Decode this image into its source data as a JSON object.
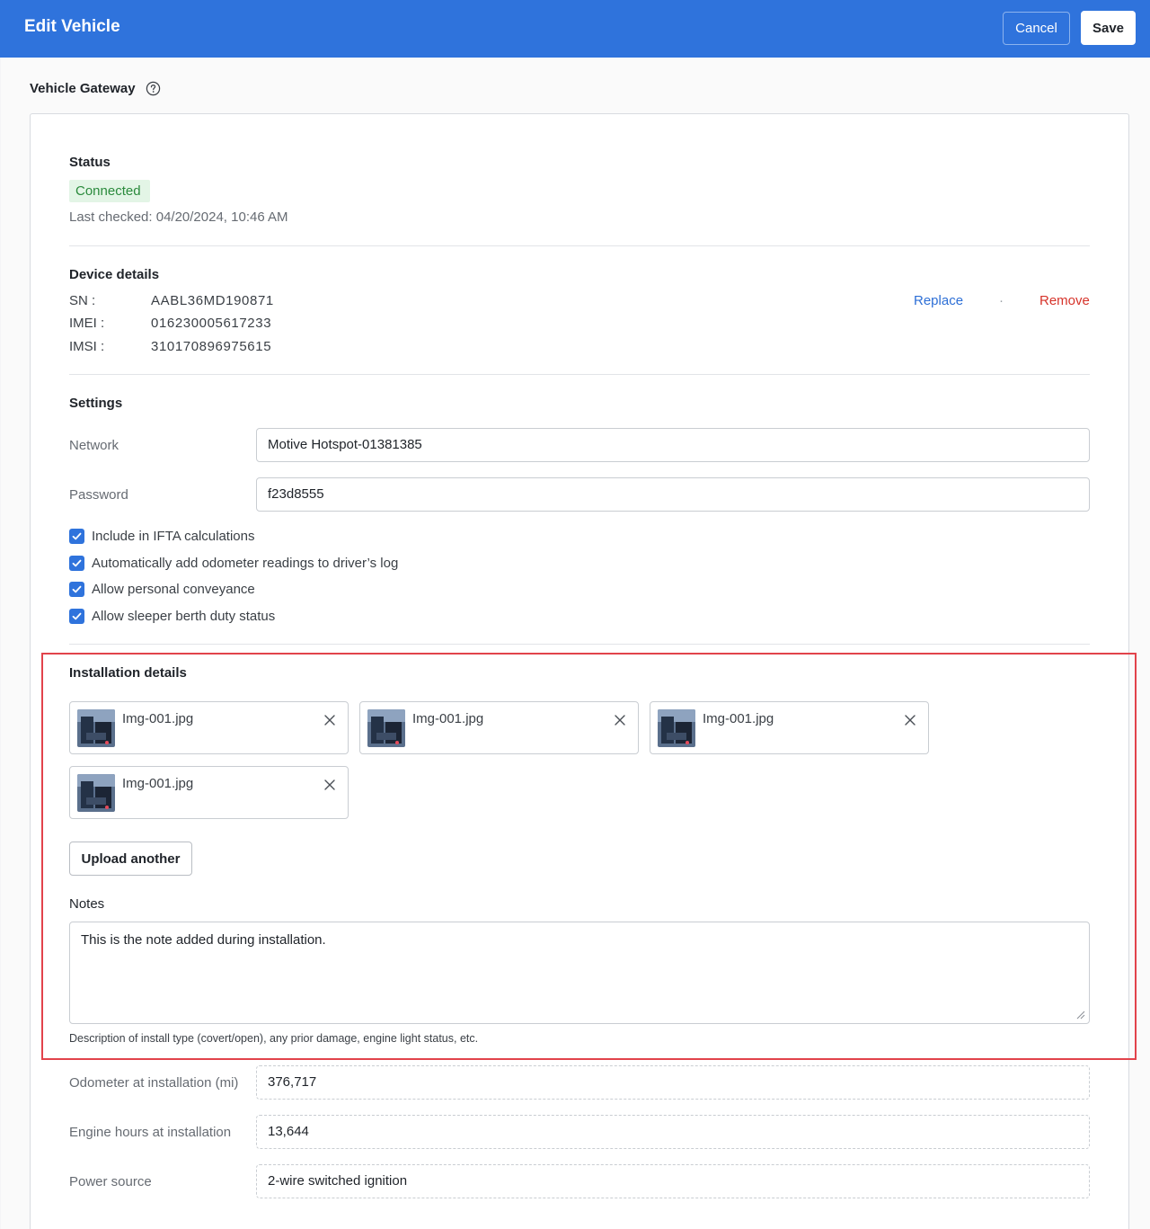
{
  "header": {
    "title": "Edit Vehicle",
    "cancel_label": "Cancel",
    "save_label": "Save",
    "accent_color": "#2f73dc"
  },
  "gateway": {
    "heading": "Vehicle Gateway",
    "help_icon": "question-circle-icon"
  },
  "status": {
    "label": "Status",
    "badge": "Connected",
    "last_checked": "Last checked: 04/20/2024, 10:46 AM"
  },
  "device": {
    "label": "Device details",
    "rows": [
      {
        "key": "SN :",
        "value": "AABL36MD190871"
      },
      {
        "key": "IMEI :",
        "value": "016230005617233"
      },
      {
        "key": "IMSI :",
        "value": "310170896975615"
      }
    ],
    "replace_label": "Replace",
    "separator": "·",
    "remove_label": "Remove"
  },
  "settings": {
    "label": "Settings",
    "network_label": "Network",
    "network_value": "Motive Hotspot-01381385",
    "password_label": "Password",
    "password_value": "f23d8555",
    "checkboxes": [
      {
        "label": "Include in IFTA calculations",
        "checked": true
      },
      {
        "label": "Automatically add odometer readings to driver’s log",
        "checked": true
      },
      {
        "label": "Allow personal conveyance",
        "checked": true
      },
      {
        "label": "Allow sleeper berth duty status",
        "checked": true
      }
    ]
  },
  "installation": {
    "label": "Installation details",
    "files": [
      {
        "name": "Img-001.jpg"
      },
      {
        "name": "Img-001.jpg"
      },
      {
        "name": "Img-001.jpg"
      },
      {
        "name": "Img-001.jpg"
      }
    ],
    "upload_label": "Upload another",
    "notes_label": "Notes",
    "notes_value": "This is the note added during installation.",
    "notes_help": "Description of install type (covert/open), any prior damage, engine light status, etc.",
    "highlight_color": "#e2434b"
  },
  "readings": {
    "odometer_label": "Odometer at installation (mi)",
    "odometer_value": "376,717",
    "engine_hours_label": "Engine hours at installation",
    "engine_hours_value": "13,644",
    "power_label": "Power source",
    "power_value": "2-wire switched ignition"
  }
}
